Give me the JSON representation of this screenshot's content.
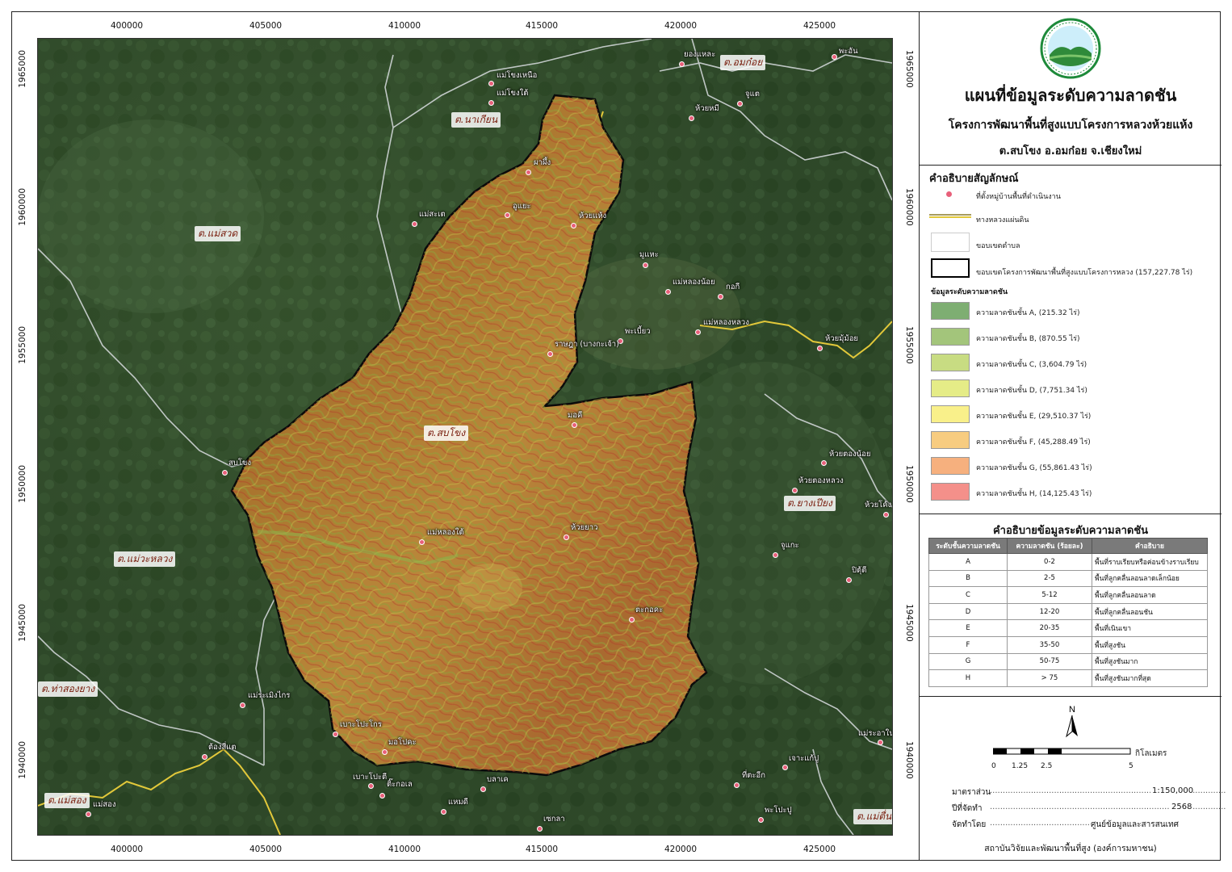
{
  "coords": {
    "x": [
      "400000",
      "405000",
      "410000",
      "415000",
      "420000",
      "425000"
    ],
    "y": [
      "1965000",
      "1960000",
      "1955000",
      "1950000",
      "1945000",
      "1940000"
    ]
  },
  "map": {
    "subdistricts": [
      "ต.นาเกียน",
      "ต.อมก๋อย",
      "ต.แม่สวด",
      "ต.สบโขง",
      "ต.แม่วะหลวง",
      "ต.ท่าสองยาง",
      "ต.ยางเปียง",
      "ต.แม่สอง",
      "ต.แม่ตื่น"
    ],
    "villages": [
      "แม่โขงเหนือ",
      "แม่โขงใต้",
      "ผาผึ้ง",
      "อูแยะ",
      "ห้วยแห้ง",
      "แม่สะเต",
      "ยองแหละ",
      "ห้วยหมี",
      "จูแต",
      "พะอัน",
      "มูแหะ",
      "แม่หลองน้อย",
      "กอกี",
      "แม่หลองหลวง",
      "พะเบี้ยว",
      "ห้วยมุ้ม้อย",
      "ราษฎา (บางกะเจ้า)",
      "มอคี",
      "สบโขง",
      "ห้วยตองน้อย",
      "ห้วยตองหลวง",
      "ห้วยโค้ง",
      "แม่หลองใต้",
      "ห้วยยาว",
      "จูแกะ",
      "ปิตุ้ตี",
      "ตะกอคะ",
      "แม่ระเมิงไกร",
      "เบาะโปะโกร",
      "มอโปคะ",
      "ต้องสี่แต",
      "แม่สอง",
      "เบาะโปะตี",
      "ติ๊ะกอเล",
      "บลาเค",
      "แหมดี",
      "เซกลา",
      "ที่ตะอีก",
      "เจาะแก้ปู",
      "พะโปะปู",
      "แม่ระอาใน"
    ]
  },
  "panel": {
    "title": "แผนที่ข้อมูลระดับความลาดชัน",
    "subtitle": "โครงการพัฒนาพื้นที่สูงแบบโครงการหลวงห้วยแห้ง",
    "location": "ต.สบโขง อ.อมก๋อย จ.เชียงใหม่",
    "legend": {
      "title": "คำอธิบายสัญลักษณ์",
      "village": "ที่ตั้งหมู่บ้านพื้นที่ดำเนินงาน",
      "highway": "ทางหลวงแผ่นดิน",
      "subdistrict": "ขอบเขตตำบล",
      "project": "ขอบเขตโครงการพัฒนาพื้นที่สูงแบบโครงการหลวง (157,227.78 ไร่)",
      "slope_title": "ข้อมูลระดับความลาดชัน",
      "classes": [
        {
          "label": "ความลาดชันชั้น  A, (215.32 ไร่)",
          "color": "#7eae72"
        },
        {
          "label": "ความลาดชันชั้น  B, (870.55 ไร่)",
          "color": "#a3c57b"
        },
        {
          "label": "ความลาดชันชั้น  C, (3,604.79 ไร่)",
          "color": "#c8dc82"
        },
        {
          "label": "ความลาดชันชั้น  D, (7,751.34 ไร่)",
          "color": "#e5ec87"
        },
        {
          "label": "ความลาดชันชั้น  E, (29,510.37 ไร่)",
          "color": "#f9f08a"
        },
        {
          "label": "ความลาดชันชั้น  F, (45,288.49 ไร่)",
          "color": "#f7cc80"
        },
        {
          "label": "ความลาดชันชั้น  G, (55,861.43 ไร่)",
          "color": "#f6b07e"
        },
        {
          "label": "ความลาดชันชั้น  H, (14,125.43 ไร่)",
          "color": "#f4908a"
        }
      ]
    },
    "table": {
      "title": "คำอธิบายข้อมูลระดับความลาดชัน",
      "headers": [
        "ระดับชั้นความลาดชัน",
        "ความลาดชัน (ร้อยละ)",
        "คำอธิบาย"
      ],
      "rows": [
        [
          "A",
          "0-2",
          "พื้นที่ราบเรียบหรือค่อนข้างราบเรียบ"
        ],
        [
          "B",
          "2-5",
          "พื้นที่ลูกคลื่นลอนลาดเล็กน้อย"
        ],
        [
          "C",
          "5-12",
          "พื้นที่ลูกคลื่นลอนลาด"
        ],
        [
          "D",
          "12-20",
          "พื้นที่ลูกคลื่นลอนชัน"
        ],
        [
          "E",
          "20-35",
          "พื้นที่เนินเขา"
        ],
        [
          "F",
          "35-50",
          "พื้นที่สูงชัน"
        ],
        [
          "G",
          "50-75",
          "พื้นที่สูงชันมาก"
        ],
        [
          "H",
          "> 75",
          "พื้นที่สูงชันมากที่สุด"
        ]
      ]
    },
    "scalebar": {
      "labels": [
        "0",
        "1.25",
        "2.5",
        "5"
      ],
      "unit": "กิโลเมตร",
      "north": "N"
    },
    "info": {
      "scale_label": "มาตราส่วน",
      "scale_value": "1:150,000",
      "year_label": "ปีที่จัดทำ",
      "year_value": "2568",
      "by_label": "จัดทำโดย",
      "by_value": "ศูนย์ข้อมูลและสารสนเทศ"
    },
    "org": "สถาบันวิจัยและพัฒนาพื้นที่สูง (องค์การมหาชน)"
  }
}
